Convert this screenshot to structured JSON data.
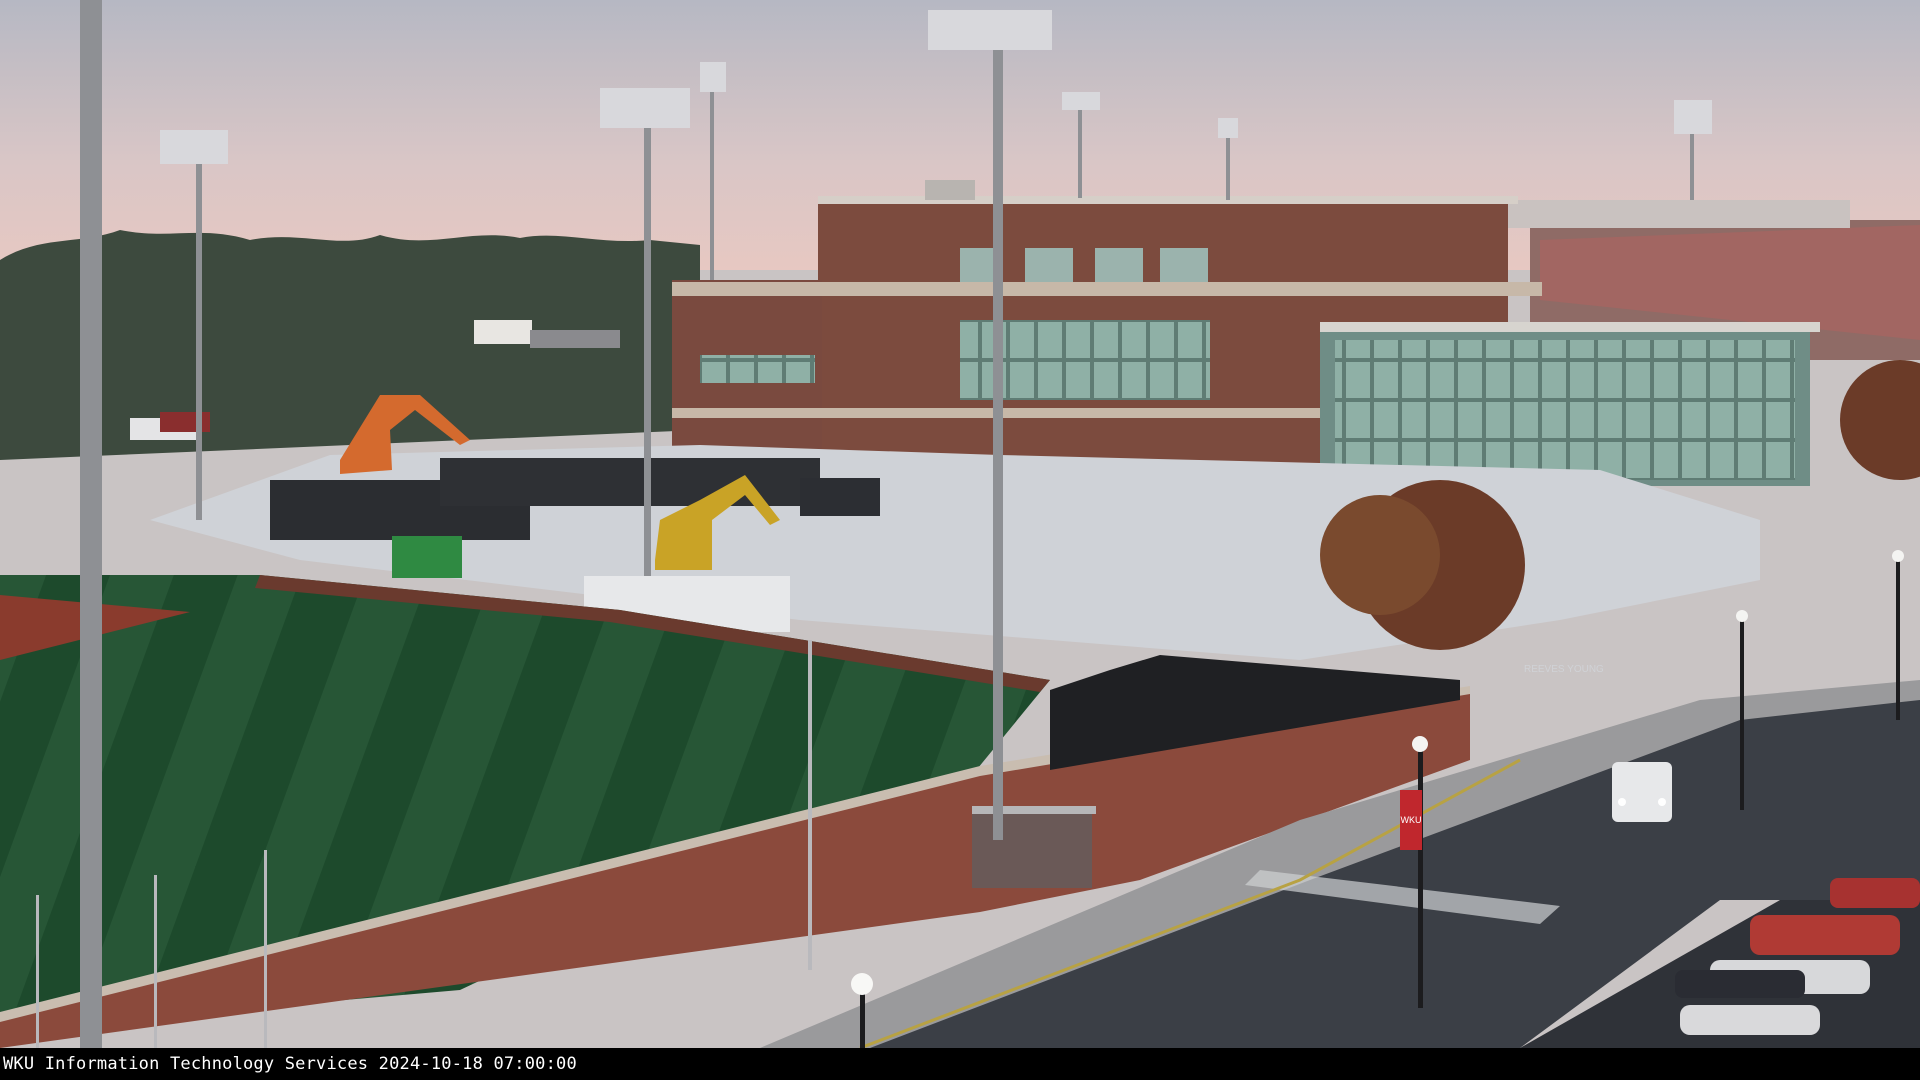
{
  "caption": {
    "text": "WKU Information Technology Services 2024-10-18 07:00:00"
  },
  "scene": {
    "street_banner_text": "WKU",
    "fence_sign_text": "REEVES YOUNG",
    "colors": {
      "sky_top": "#b6b8c3",
      "sky_horizon": "#e7c8c2",
      "turf_dark": "#1d4a2c",
      "turf_light": "#2c5e3a",
      "infield_clay": "#8a3b2d",
      "brick": "#8b4a3c",
      "building_brick": "#7c4b3e",
      "gravel": "#cfd2d7",
      "road": "#3b3f46",
      "excavator_orange": "#d46a2e",
      "excavator_yellow": "#c9a326"
    }
  }
}
